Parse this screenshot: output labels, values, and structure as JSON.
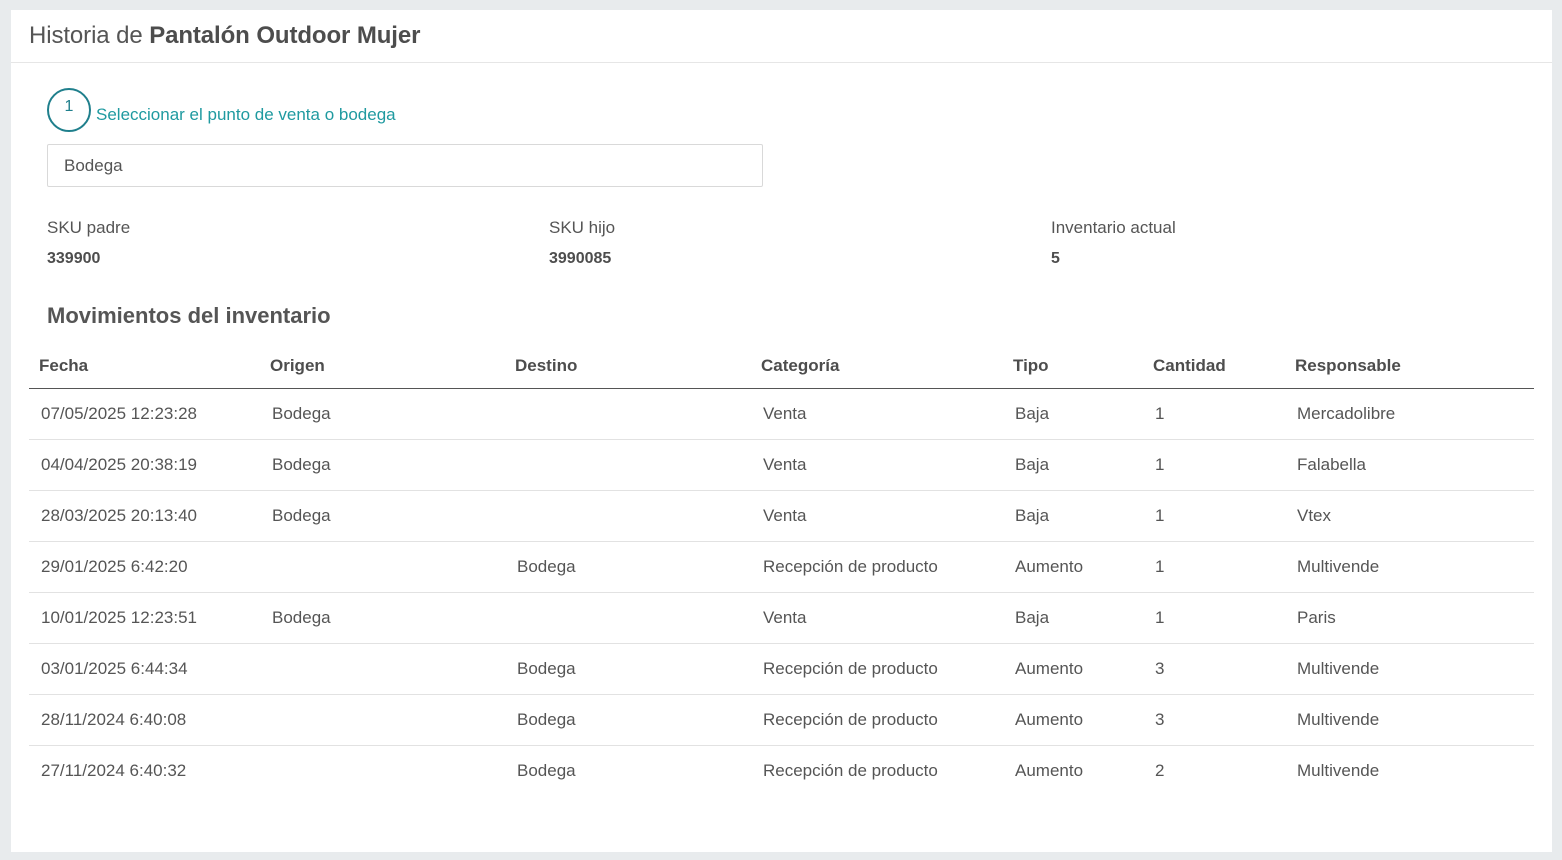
{
  "header": {
    "title_prefix": "Historia de",
    "product_name": "Pantalón Outdoor Mujer"
  },
  "step": {
    "number": "1",
    "label": "Seleccionar el punto de venta o bodega"
  },
  "location_select": {
    "value": "Bodega"
  },
  "info": {
    "sku_padre": {
      "label": "SKU padre",
      "value": "339900"
    },
    "sku_hijo": {
      "label": "SKU hijo",
      "value": "3990085"
    },
    "inventario": {
      "label": "Inventario actual",
      "value": "5"
    }
  },
  "movements": {
    "title": "Movimientos del inventario",
    "columns": [
      "Fecha",
      "Origen",
      "Destino",
      "Categoría",
      "Tipo",
      "Cantidad",
      "Responsable"
    ],
    "rows": [
      [
        "07/05/2025 12:23:28",
        "Bodega",
        "",
        "Venta",
        "Baja",
        "1",
        "Mercadolibre"
      ],
      [
        "04/04/2025 20:38:19",
        "Bodega",
        "",
        "Venta",
        "Baja",
        "1",
        "Falabella"
      ],
      [
        "28/03/2025 20:13:40",
        "Bodega",
        "",
        "Venta",
        "Baja",
        "1",
        "Vtex"
      ],
      [
        "29/01/2025 6:42:20",
        "",
        "Bodega",
        "Recepción de producto",
        "Aumento",
        "1",
        "Multivende"
      ],
      [
        "10/01/2025 12:23:51",
        "Bodega",
        "",
        "Venta",
        "Baja",
        "1",
        "Paris"
      ],
      [
        "03/01/2025 6:44:34",
        "",
        "Bodega",
        "Recepción de producto",
        "Aumento",
        "3",
        "Multivende"
      ],
      [
        "28/11/2024 6:40:08",
        "",
        "Bodega",
        "Recepción de producto",
        "Aumento",
        "3",
        "Multivende"
      ],
      [
        "27/11/2024 6:40:32",
        "",
        "Bodega",
        "Recepción de producto",
        "Aumento",
        "2",
        "Multivende"
      ]
    ]
  },
  "colors": {
    "accent": "#1f7f8c",
    "accent_text": "#1f9aa0",
    "page_bg": "#e8ebed",
    "card_bg": "#ffffff"
  }
}
